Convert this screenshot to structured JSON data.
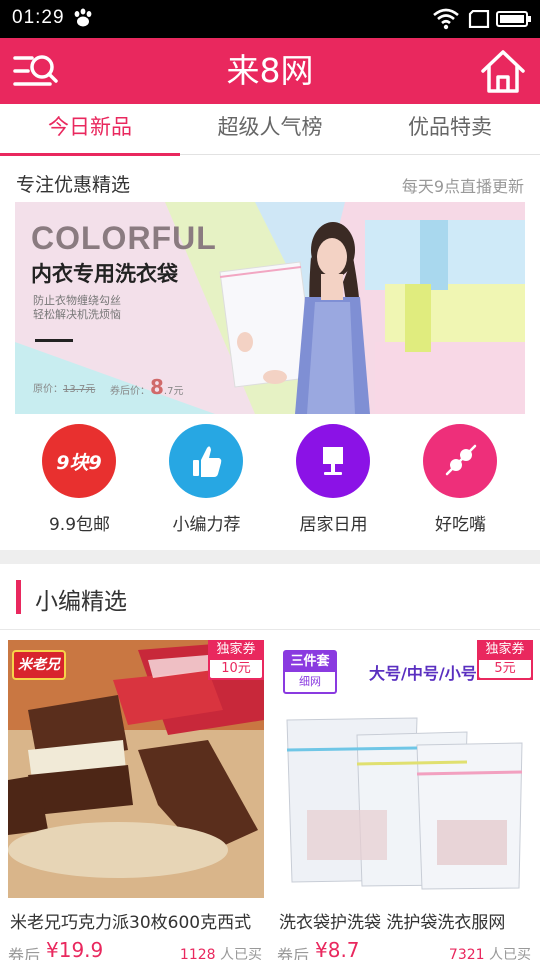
{
  "status_bar": {
    "time": "01:29"
  },
  "app_bar": {
    "title": "来8网"
  },
  "tabs": [
    {
      "label": "今日新品",
      "active": true
    },
    {
      "label": "超级人气榜",
      "active": false
    },
    {
      "label": "优品特卖",
      "active": false
    }
  ],
  "promo": {
    "title": "专注优惠精选",
    "subtitle": "每天9点直播更新",
    "banner": {
      "headline": "COLORFUL",
      "title": "内衣专用洗衣袋",
      "desc_line1": "防止衣物缠绕勾丝",
      "desc_line2": "轻松解决机洗烦恼",
      "original_price_label": "原价：",
      "original_price": "13.7元",
      "after_coupon_label": "券后价：",
      "after_coupon_big": "8",
      "after_coupon_small": ".7元"
    }
  },
  "categories": [
    {
      "label": "9.9包邮",
      "icon": "9kuai9-badge-icon",
      "icon_text": "9块9",
      "color": "#e8302f"
    },
    {
      "label": "小编力荐",
      "icon": "thumbs-up-icon",
      "color": "#27a7e3"
    },
    {
      "label": "居家日用",
      "icon": "lamp-icon",
      "color": "#8b12e6"
    },
    {
      "label": "好吃嘴",
      "icon": "skewer-icon",
      "color": "#ee2f7a"
    }
  ],
  "section": {
    "title": "小编精选"
  },
  "products": [
    {
      "name": "米老兄巧克力派30枚600克西式",
      "coupon_label": "独家券",
      "coupon_value": "10元",
      "price_label": "券后",
      "price": "¥19.9",
      "bought_count": "1128",
      "bought_suffix": "人已买",
      "brand_badge": "米老兄"
    },
    {
      "name": "洗衣袋护洗袋 洗护袋洗衣服网",
      "coupon_label": "独家券",
      "coupon_value": "5元",
      "price_label": "券后",
      "price": "¥8.7",
      "bought_count": "7321",
      "bought_suffix": "人已买",
      "badge_line1": "三件套",
      "badge_line2": "细网",
      "size_text": "大号/中号/小号"
    }
  ],
  "colors": {
    "accent": "#e9285e",
    "status_bar": "#000000"
  }
}
